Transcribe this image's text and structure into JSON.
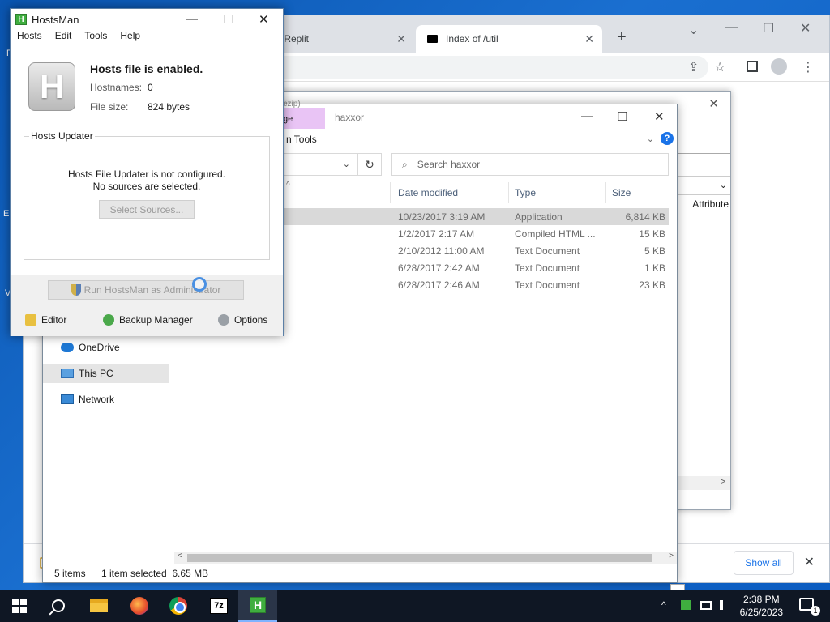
{
  "desktop": {
    "edge_text_left_1": "F",
    "edge_text_left_2": "Er",
    "edge_text_left_3": "V"
  },
  "chrome": {
    "tab1_label": "- Replit",
    "tab2_label": "Index of /util",
    "tab_close": "✕",
    "new_tab": "+",
    "ctrl_down": "⌄",
    "ctrl_min": "—",
    "ctrl_max": "☐",
    "ctrl_close": "✕",
    "share_icon": "⇪",
    "star_icon": "☆",
    "menu_icon": "⋮",
    "show_all": "Show all",
    "notif_close": "✕"
  },
  "back_window": {
    "close": "✕",
    "attribute_header": "Attribute",
    "sort_chevron": "⌄",
    "scroll_right": ">"
  },
  "explorer": {
    "ribbon_tab_fragment": "ge",
    "title": "haxxor",
    "ribbon_label": "n Tools",
    "help": "?",
    "ribbon_chevron": "⌄",
    "path_fragment": "ezip)",
    "search_placeholder": "Search haxxor",
    "refresh": "↻",
    "addr_chevron": "⌄",
    "sort_arrow": "^",
    "columns": [
      "Date modified",
      "Type",
      "Size"
    ],
    "rows": [
      {
        "date": "10/23/2017 3:19 AM",
        "type": "Application",
        "size": "6,814 KB"
      },
      {
        "date": "1/2/2017 2:17 AM",
        "type": "Compiled HTML ...",
        "size": "15 KB"
      },
      {
        "date": "2/10/2012 11:00 AM",
        "type": "Text Document",
        "size": "5 KB"
      },
      {
        "date": "6/28/2017 2:42 AM",
        "type": "Text Document",
        "size": "1 KB"
      },
      {
        "date": "6/28/2017 2:46 AM",
        "type": "Text Document",
        "size": "23 KB"
      }
    ],
    "nav": [
      {
        "label": "OneDrive",
        "icon": "onedrive-icon"
      },
      {
        "label": "This PC",
        "icon": "this-pc-icon"
      },
      {
        "label": "Network",
        "icon": "network-icon"
      }
    ],
    "status_items": "5 items",
    "status_selected": "1 item selected  6.65 MB",
    "win_min": "—",
    "win_max": "☐",
    "win_close": "✕",
    "scroll_left": "<",
    "scroll_right": ">"
  },
  "hostsman": {
    "title": "HostsMan",
    "logo_letter": "H",
    "menu": [
      "Hosts",
      "Edit",
      "Tools",
      "Help"
    ],
    "status": "Hosts file is enabled.",
    "hostnames_label": "Hostnames:",
    "hostnames_value": "0",
    "filesize_label": "File size:",
    "filesize_value": "824 bytes",
    "updater_legend": "Hosts Updater",
    "updater_line1": "Hosts File Updater is not configured.",
    "updater_line2": "No sources are selected.",
    "select_sources": "Select Sources...",
    "run_admin": "Run HostsMan as Administrator",
    "bottom": [
      "Editor",
      "Backup Manager",
      "Options"
    ],
    "win_min": "—",
    "win_max": "☐",
    "win_close": "✕"
  },
  "taskbar": {
    "sevenz": "7z",
    "hm_letter": "H",
    "tray_chevron": "^",
    "time": "2:38 PM",
    "date": "6/25/2023",
    "notif_count": "1"
  }
}
